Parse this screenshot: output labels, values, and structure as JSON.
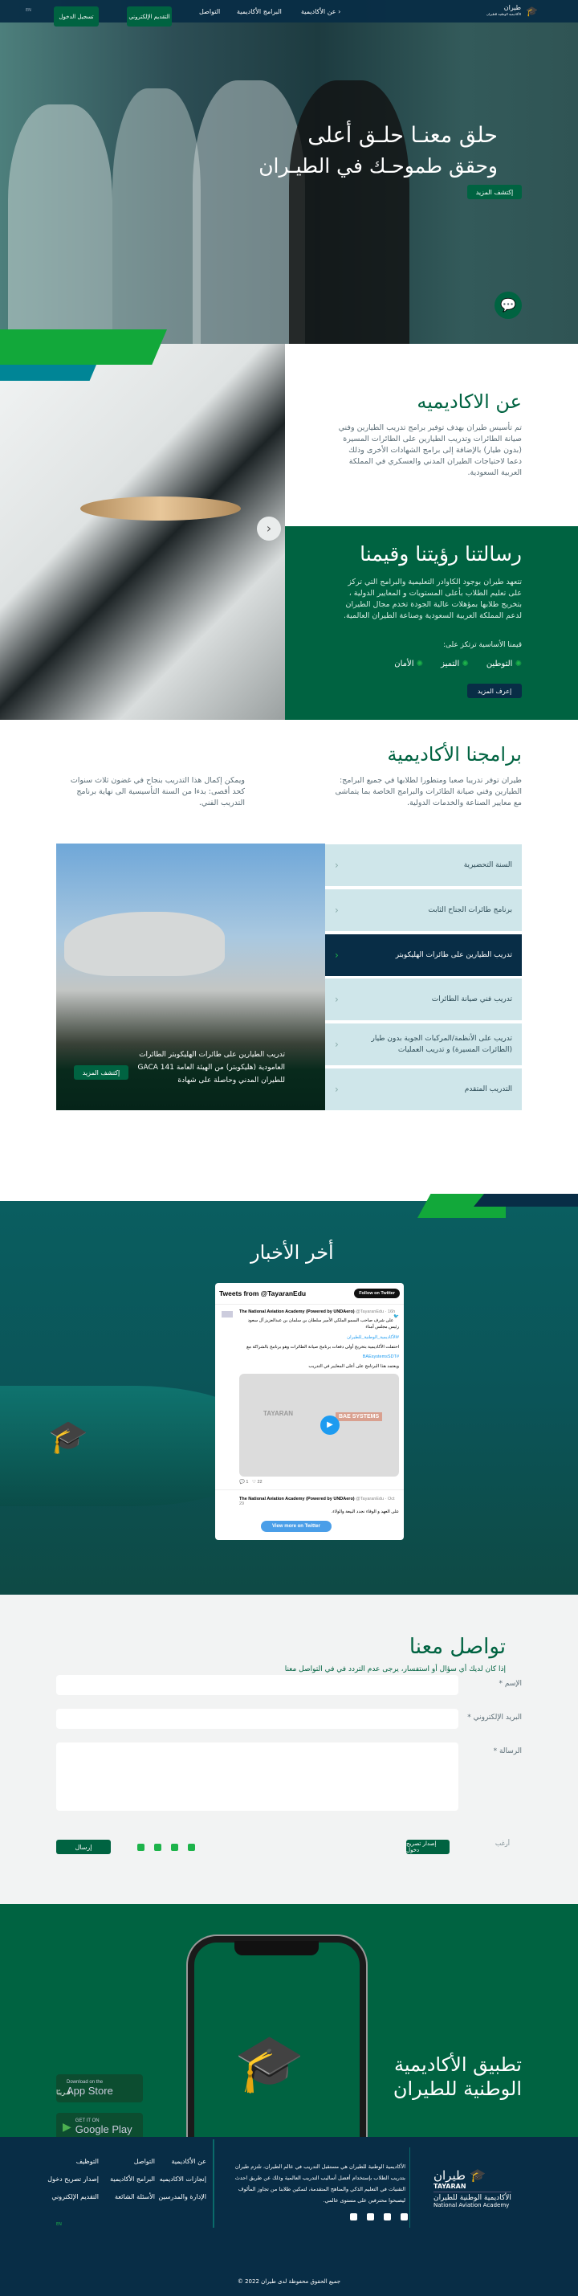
{
  "header": {
    "logo_text": "طيران",
    "logo_sub": "الأكاديمية الوطنية للطيران",
    "nav": [
      "عن الأكاديمية",
      "البرامج الأكاديمية",
      "التواصل"
    ],
    "apply_label": "التقديم الإلكتروني",
    "login_label": "تسجيل الدخول",
    "lang": "EN"
  },
  "hero": {
    "line1": "حلق معنـا حلـق أعلى",
    "line2": "وحقق طموحـك في الطيـران",
    "cta": "إكتشف المزيد"
  },
  "about": {
    "title": "عن الاكاديميه",
    "text": "تم تأسيس طيران بهدف توفير برامج تدريب الطيارين وفني صيانة الطائرات وتدريب الطيارين على الطائرات المسيرة (بدون طيار) بالإضافة إلى برامج الشهادات الأخرى وذلك دعما لاحتياجات الطيران المدني والعسكري في المملكة العربية السعودية."
  },
  "mission": {
    "title": "رسالتنا رؤيتنا وقيمنا",
    "text": "تتعهد طيران بوجود الكاوادر التعليمية والبرامج التي تركز على تعليم الطلاب بأعلى المستويات و المعايير الدولية ، بتخريج طلابها بمؤهلات عالية الجودة تخدم مجال الطيران لدعم المملكة العربية السعودية وصناعة الطيران العالمية.",
    "values_label": "قيمنا الأساسية ترتكز على:",
    "values": [
      "التوطين",
      "التميز",
      "الأمان"
    ],
    "cta": "إعرف المزيد"
  },
  "programs": {
    "title": "برامجنا الأكاديمية",
    "text1": "طيران توفر تدريبا صعبا ومتطورا لطلابها في جميع البرامج: الطيارين وفني صيانة الطائرات والبرامج الخاصة بما يتماشى مع معايير الصناعة والخدمات الدولية.",
    "text2": "ويمكن إكمال هذا التدريب بنجاح في غضون ثلاث سنوات كحد أقصى: بدءا من السنة التأسيسية الى نهاية برنامج التدريب الفني.",
    "items": [
      "السنة التحضيرية",
      "برنامج طائرات الجناح الثابت",
      "تدريب الطيارين على طائرات الهليكوبتر",
      "تدريب فني صيانة الطائرات",
      "تدريب على الأنظمة/المركبات الجوية بدون طيار (الطائرات المسيرة) و تدريب العمليات",
      "التدريب المتقدم"
    ],
    "active_index": 2,
    "caption": "تدريب الطيارين على طائرات الهليكوبتر الطائرات العامودية (هليكوبتر) من الهيئة العامة GACA 141 للطيران المدني وحاصلة على شهادة",
    "cta": "إكتشف المزيد"
  },
  "news": {
    "title": "أخر الأخبار",
    "widget_title": "Tweets from @TayaranEdu",
    "follow": "Follow on Twitter",
    "tweets": [
      {
        "author": "The National Aviation Academy (Powered by UNDAero)",
        "handle": "@TayaranEdu · 16h",
        "text": "على شرف صاحب السمو الملكي الأمير سلطان بن سلمان بن عبدالعزيز آل سعود رئيس مجلس أمناء",
        "tag1": "#الأكاديمية_الوطنية_للطيران",
        "text2": "احتفلت الأكاديمية بتخريج أولى دفعات برنامج صيانة الطائرات وهو برنامج بالشراكة مع",
        "tag2": "#BAEsystemsSDT",
        "text3": "ويعتمد هذا البرنامج على أعلى المعايير في التدريب",
        "media_brand": "BAE SYSTEMS",
        "media_logo": "TAYARAN",
        "replies": "1",
        "likes": "22"
      },
      {
        "author": "The National Aviation Academy (Powered by UNDAero)",
        "handle": "@TayaranEdu · Oct 29",
        "text": "على العهد و الوفاء نجدد البيعة والولاء."
      }
    ],
    "view_more": "View more on Twitter"
  },
  "contact": {
    "title": "تواصل معنا",
    "subtitle": "إذا كان لديك أي سؤال أو استفسار، يرجى عدم التردد في في التواصل معنا",
    "name_label": "الإسم *",
    "email_label": "البريد الإلكتروني *",
    "message_label": "الرسالة *",
    "want_label": "أرغب",
    "permit_btn": "إصدار تصريح دخول",
    "send_btn": "إرسال"
  },
  "app": {
    "title1": "تطبيق الأكاديمية",
    "title2": "الوطنية للطيران",
    "appstore_small": "Download on the",
    "appstore": "App Store",
    "gplay_small": "GET IT ON",
    "gplay": "Google Play",
    "soon": "قـريبًا"
  },
  "footer": {
    "logo_ar": "طيران",
    "logo_en": "TAYARAN",
    "academy_ar": "الأكاديمية الوطنية للطيران",
    "academy_en": "National Aviation Academy",
    "about": "الأكاديمية الوطنية للطيران هي مستقبل التدريب في عالم الطيران، تلتزم طيران بتدريب الطلاب بإستخدام أفضل أساليب التدريب العالمية وذلك عن طريق احدث التقنيات في التعليم الذكي والمناهج المتقدمة، لتمكين طلابنا من تجاوز المألوف ليصبحوا محترفين على مستوى عالمي.",
    "links": [
      [
        "عن الأكاديمية",
        "التواصل",
        "التوظيف"
      ],
      [
        "إنجازات الاكاديميه",
        "البرامج الأكاديمية",
        "إصدار تصريح دخول"
      ],
      [
        "الإدارة والمدرسين",
        "الأسئلة الشائعة",
        "التقديم الإلكتروني"
      ]
    ],
    "lang": "EN",
    "copyright": "جميع الحقوق محفوظة لدى طيران 2022 ©"
  },
  "colors": {
    "green": "#006341",
    "navy": "#082d46",
    "accent": "#1db34a",
    "teal": "#0a5e60"
  }
}
